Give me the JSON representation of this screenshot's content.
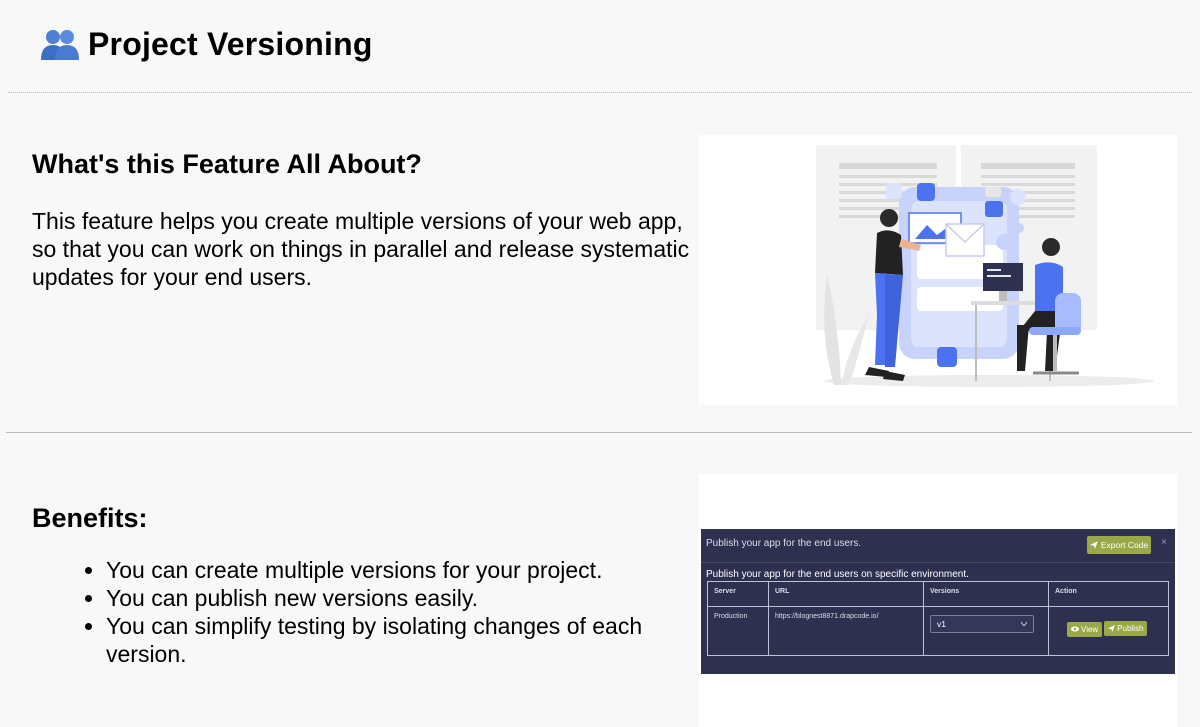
{
  "header": {
    "title": "Project Versioning",
    "icon": "users-icon",
    "icon_color": "#3a6fc8"
  },
  "feature": {
    "heading": "What's this Feature All About?",
    "description": "This feature helps you create multiple versions of your web app, so that you can work on things in parallel and release systematic updates for your end users."
  },
  "benefits": {
    "heading": "Benefits:",
    "items": [
      "You can create multiple versions for your project.",
      "You can publish new versions easily.",
      "You can simplify testing by isolating changes of each version."
    ]
  },
  "illustration": {
    "accent": "#4d72f0"
  },
  "publish_dialog": {
    "title": "Publish your app for the end users.",
    "export_label": "Export Code",
    "close_symbol": "×",
    "subtitle": "Publish your app for the end users on specific environment.",
    "columns": [
      "Server",
      "URL",
      "Versions",
      "Action"
    ],
    "row": {
      "server": "Production",
      "url": "https://blognest8871.drapcode.io/",
      "version": "v1",
      "view_label": "View",
      "publish_label": "Publish"
    },
    "colors": {
      "background": "#2e3050",
      "button": "#9aa847"
    }
  }
}
